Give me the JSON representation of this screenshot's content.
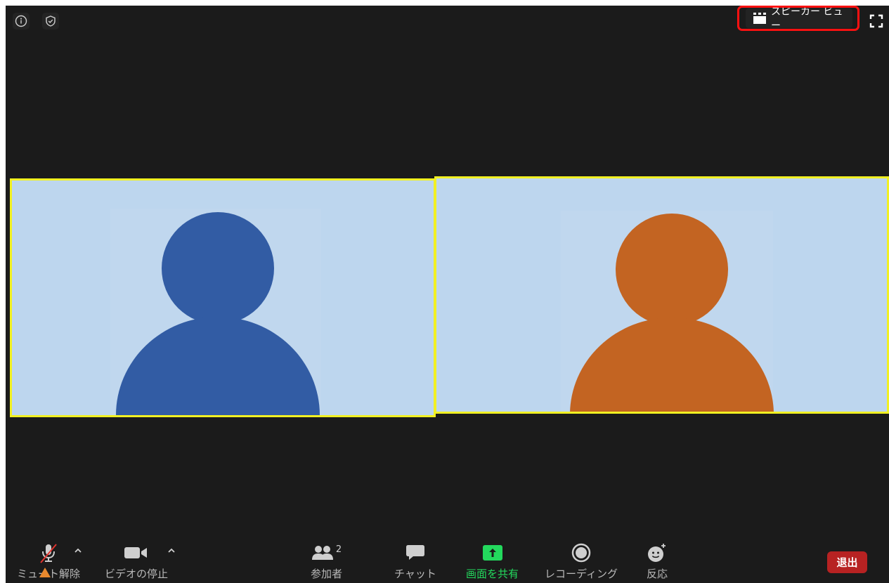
{
  "header": {
    "view_button_label": "スピーカー ビュー"
  },
  "participants_tiles": [
    {
      "avatar_color": "#325ca4"
    },
    {
      "avatar_color": "#c36422"
    }
  ],
  "toolbar": {
    "mute_label": "ミュート解除",
    "video_label": "ビデオの停止",
    "participants_label": "参加者",
    "participants_count": "2",
    "chat_label": "チャット",
    "share_label": "画面を共有",
    "record_label": "レコーディング",
    "reactions_label": "反応",
    "leave_label": "退出"
  },
  "colors": {
    "background": "#1b1b1b",
    "tile_border": "#f1f022",
    "tile_bg": "#bdd6ee",
    "share_green": "#23d95d",
    "leave_red": "#b72222",
    "highlight_red": "#ff1111"
  },
  "icons": {
    "info": "info-icon",
    "security": "shield-icon",
    "view": "gallery-grid-icon",
    "fullscreen": "fullscreen-icon",
    "mic_muted": "mic-muted-icon",
    "video": "video-camera-icon",
    "participants": "people-icon",
    "chat": "chat-bubble-icon",
    "share": "share-up-arrow-icon",
    "record": "record-icon",
    "reactions": "smiley-plus-icon"
  }
}
